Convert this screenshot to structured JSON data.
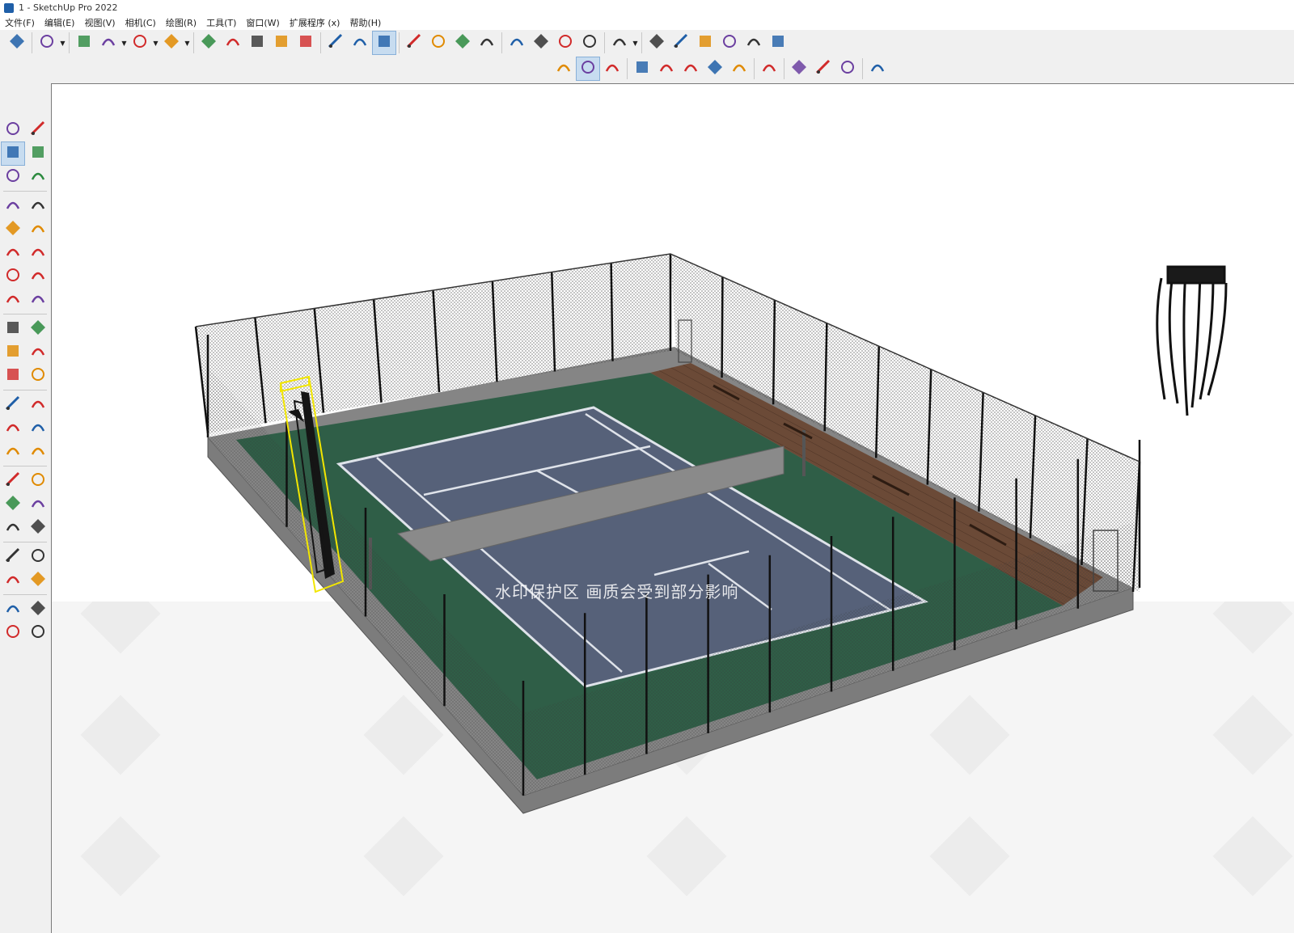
{
  "window": {
    "title": "1 - SketchUp Pro 2022"
  },
  "menu": [
    "文件(F)",
    "编辑(E)",
    "视图(V)",
    "相机(C)",
    "绘图(R)",
    "工具(T)",
    "窗口(W)",
    "扩展程序 (x)",
    "帮助(H)"
  ],
  "toolbar_row1": [
    {
      "icon": "zoom-icon"
    },
    {
      "sep": true
    },
    {
      "icon": "select-icon",
      "dropdown": true
    },
    {
      "sep": true
    },
    {
      "icon": "eraser-icon"
    },
    {
      "icon": "pencil-line-icon",
      "dropdown": true
    },
    {
      "icon": "arc-icon",
      "dropdown": true
    },
    {
      "icon": "rectangle-icon",
      "dropdown": true
    },
    {
      "sep": true
    },
    {
      "icon": "push-pull-icon"
    },
    {
      "icon": "follow-me-icon"
    },
    {
      "icon": "move-icon"
    },
    {
      "icon": "rotate-icon"
    },
    {
      "icon": "scale-icon"
    },
    {
      "sep": true
    },
    {
      "icon": "tape-measure-icon"
    },
    {
      "icon": "text-icon"
    },
    {
      "icon": "paint-bucket-icon",
      "active": true
    },
    {
      "sep": true
    },
    {
      "icon": "orbit-icon"
    },
    {
      "icon": "pan-icon"
    },
    {
      "icon": "zoom-glass-icon"
    },
    {
      "icon": "zoom-extents-icon"
    },
    {
      "sep": true
    },
    {
      "icon": "warehouse-icon"
    },
    {
      "icon": "extension-warehouse-icon"
    },
    {
      "icon": "layout-icon"
    },
    {
      "icon": "extension-manager-icon"
    },
    {
      "sep": true
    },
    {
      "icon": "user-account-icon",
      "dropdown": true
    },
    {
      "sep": true
    },
    {
      "icon": "iso-view-icon"
    },
    {
      "icon": "front-view-icon"
    },
    {
      "icon": "top-view-icon"
    },
    {
      "icon": "right-view-icon"
    },
    {
      "icon": "back-view-icon"
    },
    {
      "icon": "left-view-icon"
    }
  ],
  "toolbar_row2": [
    {
      "icon": "solid-tools-icon"
    },
    {
      "icon": "sections-icon",
      "active": true
    },
    {
      "icon": "scene-camera-icon"
    },
    {
      "sep": true
    },
    {
      "icon": "add-location-icon"
    },
    {
      "icon": "shadow-icon"
    },
    {
      "icon": "photo-texture-icon"
    },
    {
      "icon": "checker-icon"
    },
    {
      "icon": "cloud-upload-icon"
    },
    {
      "sep": true
    },
    {
      "icon": "settings-gears-icon"
    },
    {
      "sep": true
    },
    {
      "icon": "chat-icon"
    },
    {
      "icon": "info-icon"
    },
    {
      "icon": "cart-icon"
    },
    {
      "sep": true
    },
    {
      "icon": "profile-icon"
    }
  ],
  "left_toolbar": [
    [
      {
        "icon": "select-icon"
      },
      {
        "icon": "lasso-icon"
      }
    ],
    [
      {
        "icon": "paint-bucket-icon",
        "active": true
      },
      {
        "icon": "eraser-icon"
      }
    ],
    [
      {
        "icon": "make-component-icon"
      },
      {
        "icon": "tag-icon"
      }
    ],
    "sep",
    [
      {
        "icon": "pencil-line-icon"
      },
      {
        "icon": "freehand-icon"
      }
    ],
    [
      {
        "icon": "rectangle-icon"
      },
      {
        "icon": "rotated-rectangle-icon"
      }
    ],
    [
      {
        "icon": "circle-icon"
      },
      {
        "icon": "polygon-icon"
      }
    ],
    [
      {
        "icon": "arc-icon"
      },
      {
        "icon": "two-point-arc-icon"
      }
    ],
    [
      {
        "icon": "three-point-arc-icon"
      },
      {
        "icon": "pie-icon"
      }
    ],
    "sep",
    [
      {
        "icon": "move-icon"
      },
      {
        "icon": "push-pull-icon"
      }
    ],
    [
      {
        "icon": "rotate-icon"
      },
      {
        "icon": "follow-me-icon"
      }
    ],
    [
      {
        "icon": "scale-icon"
      },
      {
        "icon": "offset-icon"
      }
    ],
    "sep",
    [
      {
        "icon": "tape-measure-icon"
      },
      {
        "icon": "dimension-icon"
      }
    ],
    [
      {
        "icon": "protractor-icon"
      },
      {
        "icon": "text-icon"
      }
    ],
    [
      {
        "icon": "axes-icon"
      },
      {
        "icon": "3d-text-icon"
      }
    ],
    "sep",
    [
      {
        "icon": "orbit-icon"
      },
      {
        "icon": "pan-icon"
      }
    ],
    [
      {
        "icon": "zoom-glass-icon"
      },
      {
        "icon": "zoom-window-icon"
      }
    ],
    [
      {
        "icon": "zoom-extents-icon"
      },
      {
        "icon": "previous-view-icon"
      }
    ],
    "sep",
    [
      {
        "icon": "walk-icon"
      },
      {
        "icon": "look-around-icon"
      }
    ],
    [
      {
        "icon": "footprints-icon"
      },
      {
        "icon": "position-camera-icon"
      }
    ],
    "sep",
    [
      {
        "icon": "warehouse-icon"
      },
      {
        "icon": "extension-warehouse-icon"
      }
    ],
    [
      {
        "icon": "layout-icon"
      },
      {
        "icon": "extension-manager-icon"
      }
    ]
  ],
  "viewport": {
    "watermark": "水印保护区   画质会受到部分影响",
    "watermark_tile": "知末",
    "colors": {
      "court_surface": "#566179",
      "court_surround": "#2f5e47",
      "deck": "#6b4a37",
      "base": "#7c7c7c",
      "fence_post": "#111111",
      "net": "#888888",
      "selection": "#f2e600"
    }
  }
}
